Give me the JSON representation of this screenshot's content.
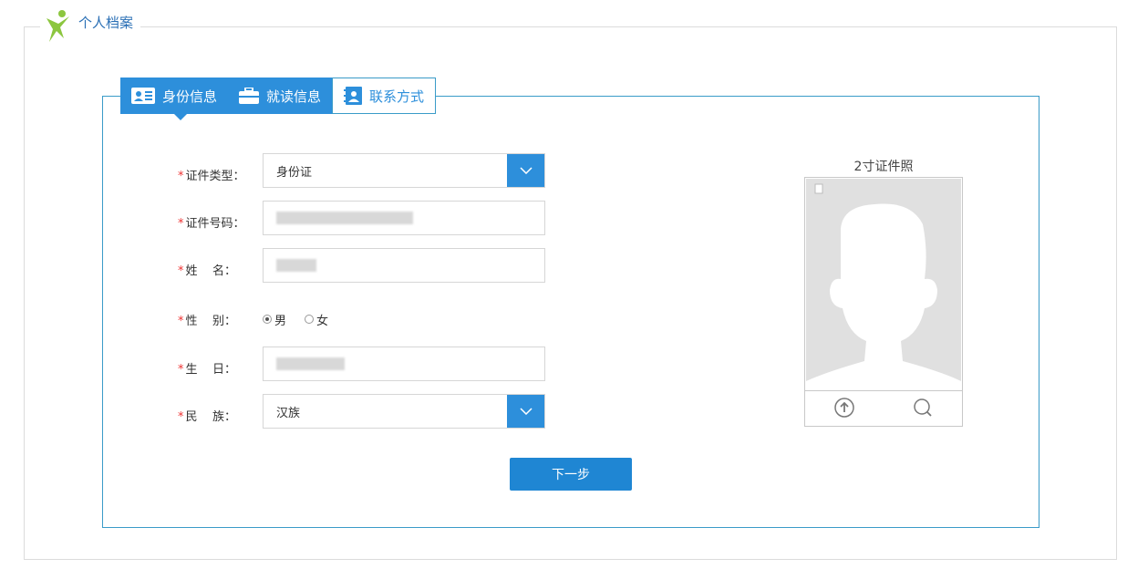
{
  "section": {
    "title": "个人档案"
  },
  "tabs": [
    {
      "label": "身份信息"
    },
    {
      "label": "就读信息"
    },
    {
      "label": "联系方式"
    }
  ],
  "form": {
    "id_type": {
      "label": "证件类型：",
      "value": "身份证"
    },
    "id_number": {
      "label": "证件号码："
    },
    "name": {
      "label": "姓    名："
    },
    "gender": {
      "label": "性    别：",
      "options": [
        "男",
        "女"
      ],
      "selected": "男"
    },
    "birthday": {
      "label": "生    日："
    },
    "ethnicity": {
      "label": "民    族：",
      "value": "汉族"
    },
    "required_mark": "*"
  },
  "next_button": {
    "label": "下一步"
  },
  "photo": {
    "title": "2寸证件照"
  },
  "colors": {
    "primary": "#2d8fdb",
    "border": "#3a9bc8",
    "required": "#e33333"
  }
}
